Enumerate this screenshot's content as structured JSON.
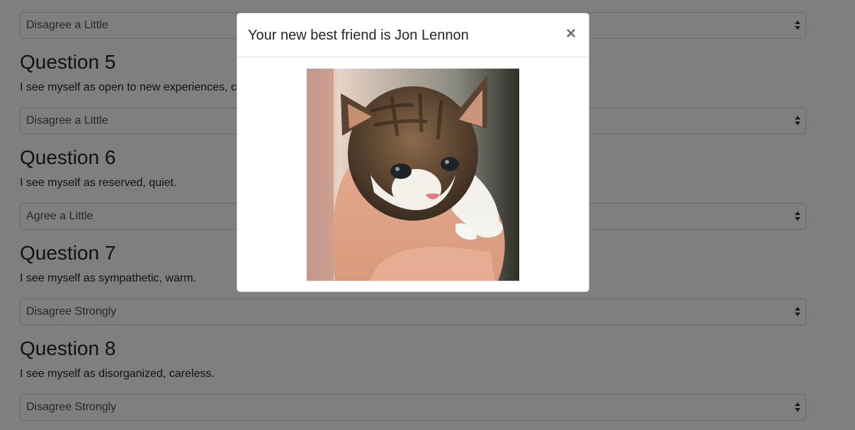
{
  "form": {
    "answer_4": "Disagree a Little",
    "questions": [
      {
        "title": "Question 5",
        "text": "I see myself as open to new experiences, complex.",
        "answer": "Disagree a Little"
      },
      {
        "title": "Question 6",
        "text": "I see myself as reserved, quiet.",
        "answer": "Agree a Little"
      },
      {
        "title": "Question 7",
        "text": "I see myself as sympathetic, warm.",
        "answer": "Disagree Strongly"
      },
      {
        "title": "Question 8",
        "text": "I see myself as disorganized, careless.",
        "answer": "Disagree Strongly"
      }
    ]
  },
  "modal": {
    "title": "Your new best friend is Jon Lennon",
    "close_label": "×",
    "image_icon": "kitten-photo"
  },
  "colors": {
    "backdrop": "rgba(0,0,0,0.5)",
    "modal_bg": "#ffffff"
  }
}
